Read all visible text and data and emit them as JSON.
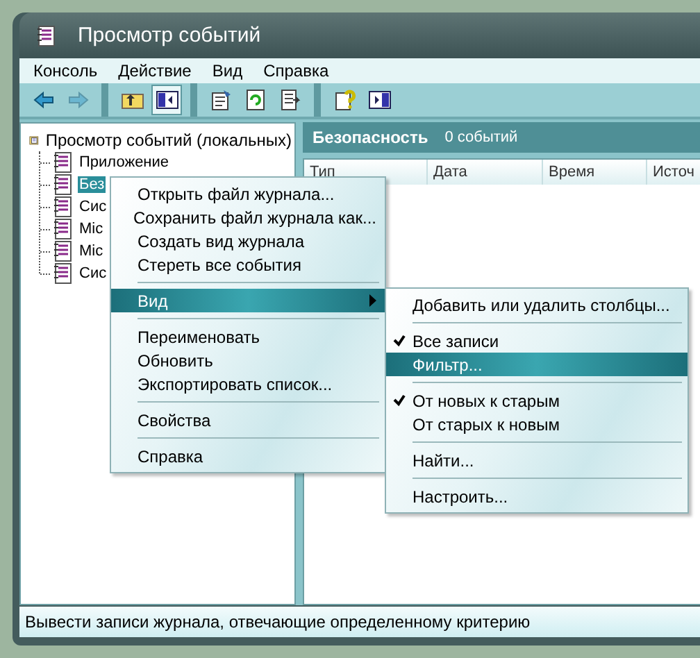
{
  "window": {
    "title": "Просмотр событий"
  },
  "menubar": [
    {
      "label": "Консоль"
    },
    {
      "label": "Действие"
    },
    {
      "label": "Вид"
    },
    {
      "label": "Справка"
    }
  ],
  "toolbar": [
    {
      "disabled": false,
      "pressed": false
    },
    {
      "disabled": true,
      "pressed": false
    },
    {
      "disabled": false,
      "pressed": false
    },
    {
      "disabled": false,
      "pressed": true
    },
    {
      "disabled": false,
      "pressed": false
    },
    {
      "disabled": false,
      "pressed": false
    },
    {
      "disabled": false,
      "pressed": false
    },
    {
      "disabled": false,
      "pressed": false
    },
    {
      "disabled": false,
      "pressed": false
    }
  ],
  "tree": {
    "label": "Просмотр событий (локальных)",
    "selected": false,
    "children": [
      {
        "label": "Приложение",
        "selected": false
      },
      {
        "label": "Без",
        "selected": true
      },
      {
        "label": "Сис",
        "selected": false
      },
      {
        "label": "Mic",
        "selected": false
      },
      {
        "label": "Mic",
        "selected": false
      },
      {
        "label": "Сис",
        "selected": false
      }
    ]
  },
  "details": {
    "title": "Безопасность",
    "count": "0 событий",
    "columns": [
      "Тип",
      "Дата",
      "Время",
      "Источ"
    ]
  },
  "context_menu": [
    {
      "kind": "item",
      "label": "Открыть файл журнала...",
      "selected": false
    },
    {
      "kind": "item",
      "label": "Сохранить файл журнала как...",
      "selected": false
    },
    {
      "kind": "item",
      "label": "Создать вид журнала",
      "selected": false
    },
    {
      "kind": "item",
      "label": "Стереть все события",
      "selected": false
    },
    {
      "kind": "separator"
    },
    {
      "kind": "submenu",
      "label": "Вид",
      "selected": true
    },
    {
      "kind": "separator"
    },
    {
      "kind": "item",
      "label": "Переименовать",
      "selected": false
    },
    {
      "kind": "item",
      "label": "Обновить",
      "selected": false
    },
    {
      "kind": "item",
      "label": "Экспортировать список...",
      "selected": false
    },
    {
      "kind": "separator"
    },
    {
      "kind": "item",
      "label": "Свойства",
      "selected": false
    },
    {
      "kind": "separator"
    },
    {
      "kind": "item",
      "label": "Справка",
      "selected": false
    }
  ],
  "submenu": [
    {
      "kind": "item",
      "label": "Добавить или удалить столбцы...",
      "selected": false,
      "checked": false
    },
    {
      "kind": "separator"
    },
    {
      "kind": "item",
      "label": "Все записи",
      "selected": false,
      "checked": true
    },
    {
      "kind": "item",
      "label": "Фильтр...",
      "selected": true,
      "checked": false
    },
    {
      "kind": "separator"
    },
    {
      "kind": "item",
      "label": "От новых к старым",
      "selected": false,
      "checked": true
    },
    {
      "kind": "item",
      "label": "От старых к новым",
      "selected": false,
      "checked": false
    },
    {
      "kind": "separator"
    },
    {
      "kind": "item",
      "label": "Найти...",
      "selected": false,
      "checked": false
    },
    {
      "kind": "separator"
    },
    {
      "kind": "item",
      "label": "Настроить...",
      "selected": false,
      "checked": false
    }
  ],
  "status_bar": "Вывести записи журнала, отвечающие определенному критерию"
}
